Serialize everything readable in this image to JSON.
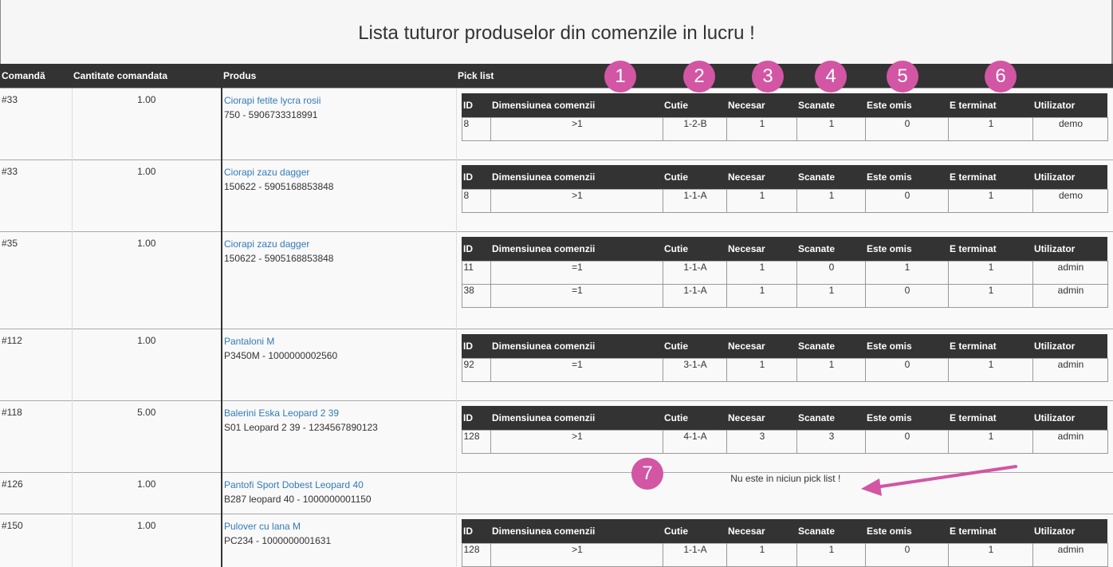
{
  "page_title": "Lista tuturor produselor din comenzile in lucru !",
  "headers": {
    "order": "Comandă",
    "qty": "Cantitate comandata",
    "product": "Produs",
    "pick_list": "Pick list"
  },
  "pick_headers": [
    "ID",
    "Dimensiunea comenzii",
    "Cutie",
    "Necesar",
    "Scanate",
    "Este omis",
    "E terminat",
    "Utilizator"
  ],
  "rows": [
    {
      "order": "#33",
      "qty": "1.00",
      "product_name": "Ciorapi fetite lycra rosii",
      "product_code": "750 - 5906733318991",
      "picks": [
        [
          "8",
          ">1",
          "1-2-B",
          "1",
          "1",
          "0",
          "1",
          "demo"
        ]
      ]
    },
    {
      "order": "#33",
      "qty": "1.00",
      "product_name": "Ciorapi zazu dagger",
      "product_code": "150622 - 5905168853848",
      "picks": [
        [
          "8",
          ">1",
          "1-1-A",
          "1",
          "1",
          "0",
          "1",
          "demo"
        ]
      ]
    },
    {
      "order": "#35",
      "qty": "1.00",
      "product_name": "Ciorapi zazu dagger",
      "product_code": "150622 - 5905168853848",
      "picks": [
        [
          "11",
          "=1",
          "1-1-A",
          "1",
          "0",
          "1",
          "1",
          "admin"
        ],
        [
          "38",
          "=1",
          "1-1-A",
          "1",
          "1",
          "0",
          "1",
          "admin"
        ]
      ]
    },
    {
      "order": "#112",
      "qty": "1.00",
      "product_name": "Pantaloni M",
      "product_code": "P3450M - 1000000002560",
      "picks": [
        [
          "92",
          "=1",
          "3-1-A",
          "1",
          "1",
          "0",
          "1",
          "admin"
        ]
      ]
    },
    {
      "order": "#118",
      "qty": "5.00",
      "product_name": "Balerini Eska Leopard 2 39",
      "product_code": "S01 Leopard 2 39 - 1234567890123",
      "picks": [
        [
          "128",
          ">1",
          "4-1-A",
          "3",
          "3",
          "0",
          "1",
          "admin"
        ]
      ]
    },
    {
      "order": "#126",
      "qty": "1.00",
      "product_name": "Pantofi Sport Dobest Leopard 40",
      "product_code": "B287 leopard 40 - 1000000001150",
      "picks": [],
      "missing_text": "Nu este in niciun pick list !"
    },
    {
      "order": "#150",
      "qty": "1.00",
      "product_name": "Pulover cu lana M",
      "product_code": "PC234 - 1000000001631",
      "picks": [
        [
          "128",
          ">1",
          "1-1-A",
          "1",
          "1",
          "0",
          "1",
          "admin"
        ]
      ]
    }
  ],
  "markers": [
    "1",
    "2",
    "3",
    "4",
    "5",
    "6",
    "7"
  ],
  "colors": {
    "header_bg": "#333333",
    "marker": "#d256a4",
    "missing_bg": "#e8b5c8",
    "link": "#337ab7"
  }
}
